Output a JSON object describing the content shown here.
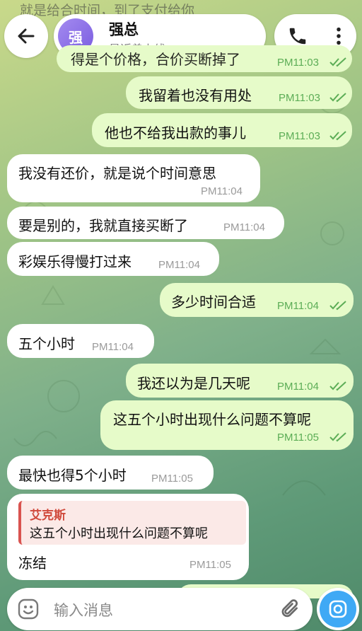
{
  "status_bar_partial": "就是给合时间，到了支付给你",
  "header": {
    "contact_name": "强总",
    "avatar_initial": "强",
    "status": "最近曾上线"
  },
  "messages": [
    {
      "dir": "out",
      "text": "得是个价格，合价买断掉了",
      "time": "PM11:03",
      "partial": true
    },
    {
      "dir": "out",
      "text": "我留着也没有用处",
      "time": "PM11:03"
    },
    {
      "dir": "out",
      "text": "他也不给我出款的事儿",
      "time": "PM11:03"
    },
    {
      "dir": "in",
      "text": "我没有还价，就是说个时间意思",
      "time": "PM11:04"
    },
    {
      "dir": "in",
      "text": "要是别的，我就直接买断了",
      "time": "PM11:04"
    },
    {
      "dir": "in",
      "text": "彩娱乐得慢打过来",
      "time": "PM11:04"
    },
    {
      "dir": "out",
      "text": "多少时间合适",
      "time": "PM11:04"
    },
    {
      "dir": "in",
      "text": "五个小时",
      "time": "PM11:04"
    },
    {
      "dir": "out",
      "text": "我还以为是几天呢",
      "time": "PM11:04"
    },
    {
      "dir": "out",
      "text": "这五个小时出现什么问题不算呢",
      "time": "PM11:05"
    },
    {
      "dir": "in",
      "text": "最快也得5个小时",
      "time": "PM11:05"
    },
    {
      "dir": "in",
      "text": "冻结",
      "time": "PM11:05",
      "reply": {
        "name": "艾克斯",
        "text": "这五个小时出现什么问题不算呢"
      }
    }
  ],
  "input": {
    "placeholder": "输入消息"
  },
  "colors": {
    "incoming": "#ffffff",
    "outgoing": "#e6fbc9",
    "tick": "#5cad56",
    "accent": "#3fa9f5",
    "quote_bar": "#d9534f"
  },
  "icons": [
    "back-arrow-icon",
    "phone-icon",
    "more-vertical-icon",
    "emoji-icon",
    "attachment-icon",
    "camera-icon",
    "double-check-icon"
  ]
}
